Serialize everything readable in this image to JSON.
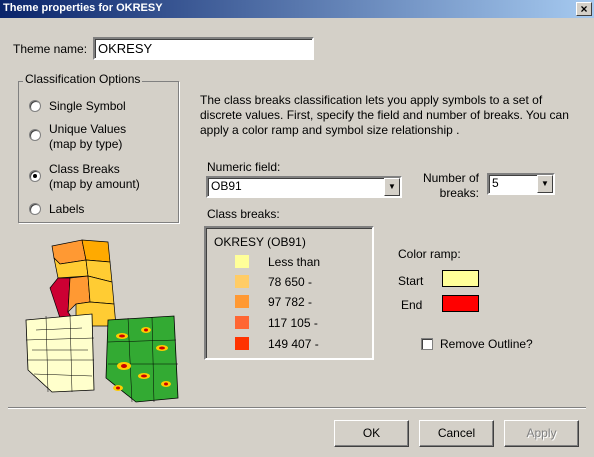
{
  "window": {
    "title": "Theme properties for OKRESY",
    "close_glyph": "×"
  },
  "theme_name": {
    "label": "Theme name:",
    "value": "OKRESY"
  },
  "classification": {
    "group_label": "Classification Options",
    "options": [
      {
        "label_line1": "Single Symbol",
        "label_line2": "",
        "checked": false
      },
      {
        "label_line1": "Unique Values",
        "label_line2": "(map by type)",
        "checked": false
      },
      {
        "label_line1": "Class Breaks",
        "label_line2": "(map by amount)",
        "checked": true
      },
      {
        "label_line1": "Labels",
        "label_line2": "",
        "checked": false
      }
    ]
  },
  "description": "The class breaks classification lets you apply symbols to a set of discrete values. First, specify the field and number of breaks. You can apply a color ramp and symbol size relationship .",
  "numeric_field": {
    "label": "Numeric field:",
    "value": "OB91"
  },
  "number_of_breaks": {
    "label_line1": "Number of",
    "label_line2": "breaks:",
    "value": "5"
  },
  "class_breaks": {
    "label": "Class breaks:",
    "title": "OKRESY (OB91)",
    "items": [
      {
        "label": "Less than",
        "color": "#ffff99"
      },
      {
        "label": "78 650 -",
        "color": "#ffcc66"
      },
      {
        "label": "97 782 -",
        "color": "#ff9933"
      },
      {
        "label": "117 105 -",
        "color": "#ff6633"
      },
      {
        "label": "149 407 -",
        "color": "#ff3300"
      }
    ]
  },
  "color_ramp": {
    "label": "Color ramp:",
    "start_label": "Start",
    "start_color": "#ffff99",
    "end_label": "End",
    "end_color": "#ff0000"
  },
  "remove_outline": {
    "label": "Remove Outline?",
    "checked": false
  },
  "buttons": {
    "ok": "OK",
    "cancel": "Cancel",
    "apply": "Apply"
  }
}
